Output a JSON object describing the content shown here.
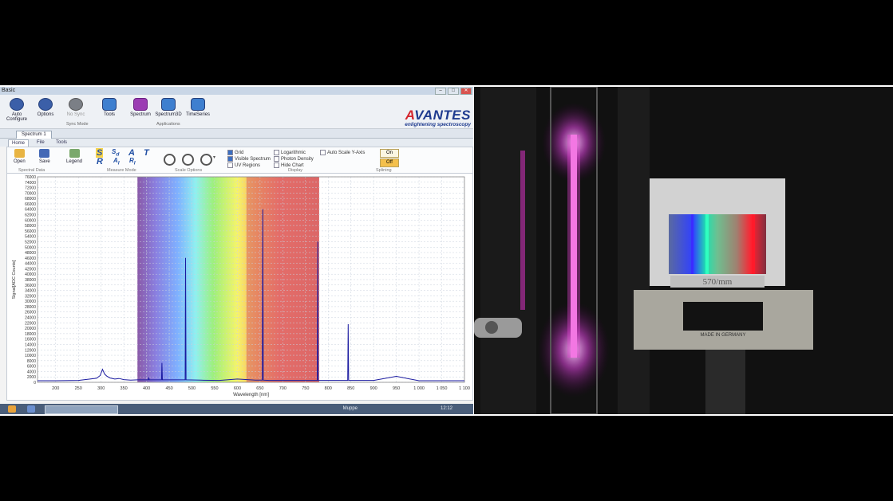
{
  "window": {
    "title": "Basic",
    "minimize": "–",
    "maximize": "□",
    "close": "✕"
  },
  "toolbar": {
    "buttons": [
      {
        "label": "Auto Configure",
        "icon": "auto-configure-icon"
      },
      {
        "label": "Options",
        "icon": "options-icon"
      },
      {
        "label": "No Sync",
        "icon": "sync-icon"
      },
      {
        "label": "Tools",
        "icon": "tools-icon"
      },
      {
        "label": "Spectrum",
        "icon": "spectrum-icon"
      },
      {
        "label": "Spectrum3D",
        "icon": "spectrum3d-icon"
      },
      {
        "label": "TimeSeries",
        "icon": "timeseries-icon"
      }
    ],
    "group_sync": "Sync Mode",
    "group_apps": "Applications"
  },
  "logo": {
    "brand_prefix": "A",
    "brand_rest": "VANTES",
    "tagline": "enlightening spectroscopy"
  },
  "doc_tab": "Spectrum 1",
  "ribbon_tabs": [
    "Home",
    "File",
    "Tools"
  ],
  "ribbon": {
    "open": "Open",
    "save": "Save",
    "legend": "Legend",
    "sect_spectral": "Spectral Data",
    "sect_measure": "Measure Mode",
    "sect_scale": "Scale Options",
    "sect_display": "Display",
    "sect_splining": "Splining",
    "display_options": [
      {
        "label": "Grid",
        "checked": true
      },
      {
        "label": "Visible Spectrum",
        "checked": true
      },
      {
        "label": "UV Regions",
        "checked": false
      },
      {
        "label": "Logarithmic",
        "checked": false
      },
      {
        "label": "Photon Density",
        "checked": false
      },
      {
        "label": "Hide Chart",
        "checked": false
      },
      {
        "label": "Auto Scale Y-Axis",
        "checked": false
      }
    ],
    "on": "On",
    "off": "Off"
  },
  "taskbar": {
    "lang": "Muppe",
    "time": "12:12"
  },
  "photo": {
    "plate_label": "570/mm",
    "made_label": "MADE IN GERMANY"
  },
  "chart_data": {
    "type": "line",
    "xlabel": "Wavelength [nm]",
    "ylabel": "Signal[ADC Counts]",
    "xlim": [
      160,
      1100
    ],
    "ylim": [
      0,
      76000
    ],
    "x_ticks": [
      "200",
      "250",
      "300",
      "350",
      "400",
      "450",
      "500",
      "550",
      "600",
      "650",
      "700",
      "750",
      "800",
      "850",
      "900",
      "950",
      "1 000",
      "1 050",
      "1 100"
    ],
    "y_ticks": [
      0,
      2000,
      4000,
      6000,
      8000,
      10000,
      12000,
      14000,
      16000,
      18000,
      20000,
      22000,
      24000,
      26000,
      28000,
      30000,
      32000,
      34000,
      36000,
      38000,
      40000,
      42000,
      44000,
      46000,
      48000,
      50000,
      52000,
      54000,
      56000,
      58000,
      60000,
      62000,
      64000,
      66000,
      68000,
      70000,
      72000,
      74000,
      76000
    ],
    "grid": true,
    "series": [
      {
        "color": "#1a1aa0",
        "x": [
          160,
          200,
          250,
          290,
          298,
          303,
          308,
          313,
          320,
          330,
          340,
          350,
          365,
          380,
          404,
          405,
          406,
          420,
          433,
          434,
          435,
          460,
          485,
          486,
          487,
          520,
          560,
          600,
          640,
          655,
          656,
          657,
          670,
          700,
          740,
          776,
          777,
          778,
          800,
          843,
          844,
          845,
          870,
          900,
          950,
          1000,
          1050,
          1100
        ],
        "y": [
          600,
          600,
          700,
          1500,
          2500,
          4800,
          3000,
          2200,
          1600,
          1200,
          1400,
          1000,
          800,
          900,
          900,
          1800,
          900,
          900,
          900,
          7200,
          900,
          900,
          900,
          46000,
          900,
          800,
          700,
          1200,
          800,
          800,
          64000,
          800,
          700,
          700,
          700,
          700,
          52000,
          700,
          700,
          700,
          21500,
          700,
          700,
          700,
          2200,
          600,
          600,
          600
        ]
      }
    ],
    "visible_band": [
      380,
      780
    ],
    "red_band": [
      620,
      780
    ]
  }
}
